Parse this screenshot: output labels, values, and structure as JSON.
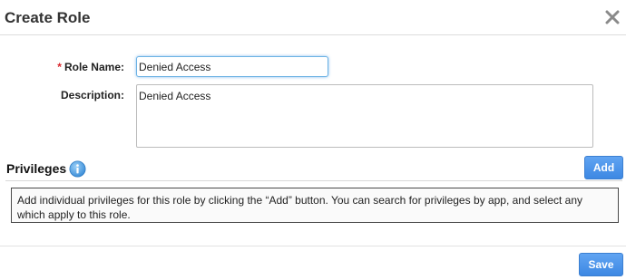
{
  "dialog": {
    "title": "Create Role",
    "close_icon": "close-x-icon"
  },
  "form": {
    "role_name_required_marker": "*",
    "role_name_label": "Role Name:",
    "role_name_value": "Denied Access",
    "description_label": "Description:",
    "description_value": "Denied Access"
  },
  "privileges": {
    "title": "Privileges",
    "info_icon": "info-icon",
    "add_label": "Add",
    "notice": "Add individual privileges for this role by clicking the “Add” button. You can search for privileges by app, and select any which apply to this role."
  },
  "footer": {
    "save_label": "Save"
  },
  "colors": {
    "accent": "#4a90e2",
    "required": "#d9252b",
    "info": "#3d8fd9"
  }
}
